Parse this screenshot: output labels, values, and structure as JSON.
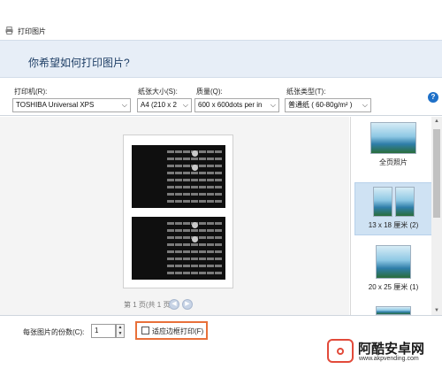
{
  "window": {
    "title": "打印图片",
    "icon": "printer-icon"
  },
  "header": {
    "heading": "你希望如何打印图片?"
  },
  "options": {
    "printer_label": "打印机(R):",
    "printer_value": "TOSHIBA Universal XPS",
    "paper_size_label": "纸张大小(S):",
    "paper_size_value": "A4 (210 x 2",
    "quality_label": "质量(Q):",
    "quality_value": "600 x 600dots per in",
    "paper_type_label": "纸张类型(T):",
    "paper_type_value": "普通纸 ( 60-80g/m² )",
    "help_glyph": "?"
  },
  "preview": {
    "page_info": "第 1 页(共 1 页)",
    "prev_icon": "arrow-left-icon",
    "next_icon": "arrow-right-icon"
  },
  "layouts": [
    {
      "label": "全页照片",
      "selected": false
    },
    {
      "label": "13 x 18 厘米 (2)",
      "selected": true
    },
    {
      "label": "20 x 25 厘米 (1)",
      "selected": false
    }
  ],
  "footer": {
    "copies_label": "每张图片的份数(C):",
    "copies_value": "1",
    "fit_label": "适应边框打印(F)",
    "fit_checked": false
  },
  "watermark": {
    "name": "阿酷安卓网",
    "url": "www.akpvending.com"
  },
  "colors": {
    "header_bg": "#e7eef7",
    "highlight_border": "#e8703a",
    "selected_bg": "#cfe2f3",
    "help_blue": "#1e70c8"
  }
}
